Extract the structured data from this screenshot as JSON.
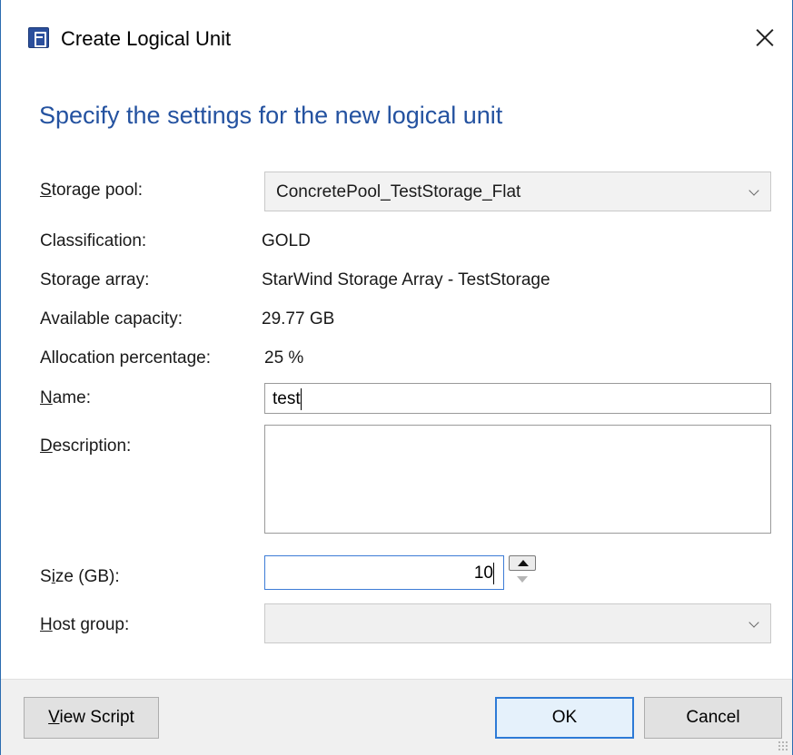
{
  "window": {
    "title": "Create Logical Unit",
    "icon": "app-icon"
  },
  "heading": "Specify the settings for the new logical unit",
  "form": {
    "storage_pool": {
      "label_ak": "S",
      "label_rest": "torage pool:",
      "selected": "ConcretePool_TestStorage_Flat"
    },
    "classification": {
      "label": "Classification:",
      "value": "GOLD"
    },
    "storage_array": {
      "label": "Storage array:",
      "value": "StarWind Storage Array - TestStorage"
    },
    "available_capacity": {
      "label": "Available capacity:",
      "value": "29.77 GB"
    },
    "allocation_percentage": {
      "label": "Allocation percentage:",
      "value": "25 %"
    },
    "name": {
      "label_ak": "N",
      "label_rest": "ame:",
      "value": "test"
    },
    "description": {
      "label_ak": "D",
      "label_rest": "escription:",
      "value": ""
    },
    "size": {
      "label_pre": "S",
      "label_ak": "i",
      "label_rest": "ze (GB):",
      "value": "10"
    },
    "host_group": {
      "label_ak": "H",
      "label_rest": "ost group:",
      "selected": ""
    }
  },
  "footer": {
    "view_script": {
      "label_ak": "V",
      "label_rest": "iew Script"
    },
    "ok_label": "OK",
    "cancel_label": "Cancel"
  },
  "colors": {
    "heading": "#2452a0",
    "accent": "#2d7ad6"
  }
}
